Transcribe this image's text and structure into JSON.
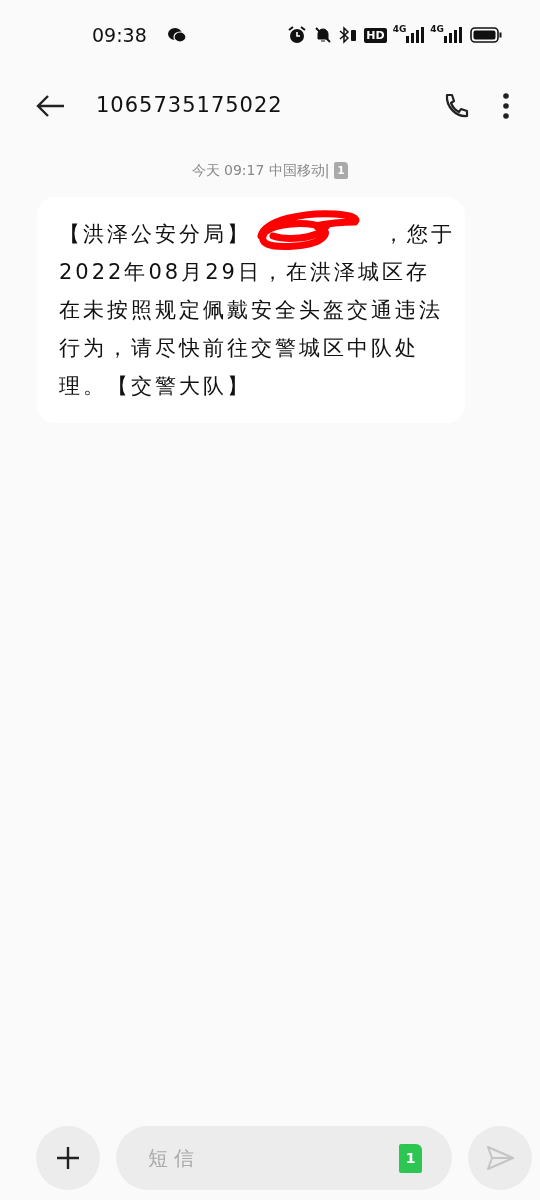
{
  "status_bar": {
    "time": "09:38",
    "network_1": "4G",
    "network_2": "4G",
    "hd": "HD"
  },
  "header": {
    "title": "1065735175022"
  },
  "timestamp": {
    "text": "今天 09:17 中国移动|",
    "sim": "1"
  },
  "message": {
    "text_start": "【洪泽公安分局】",
    "redacted": true,
    "text_after": "，您于",
    "text_end": "2022年08月29日，在洪泽城区存在未按照规定佩戴安全头盔交通违法行为，请尽快前往交警城区中队处理。【交警大队】"
  },
  "composer": {
    "placeholder": "短信",
    "sim": "1"
  }
}
